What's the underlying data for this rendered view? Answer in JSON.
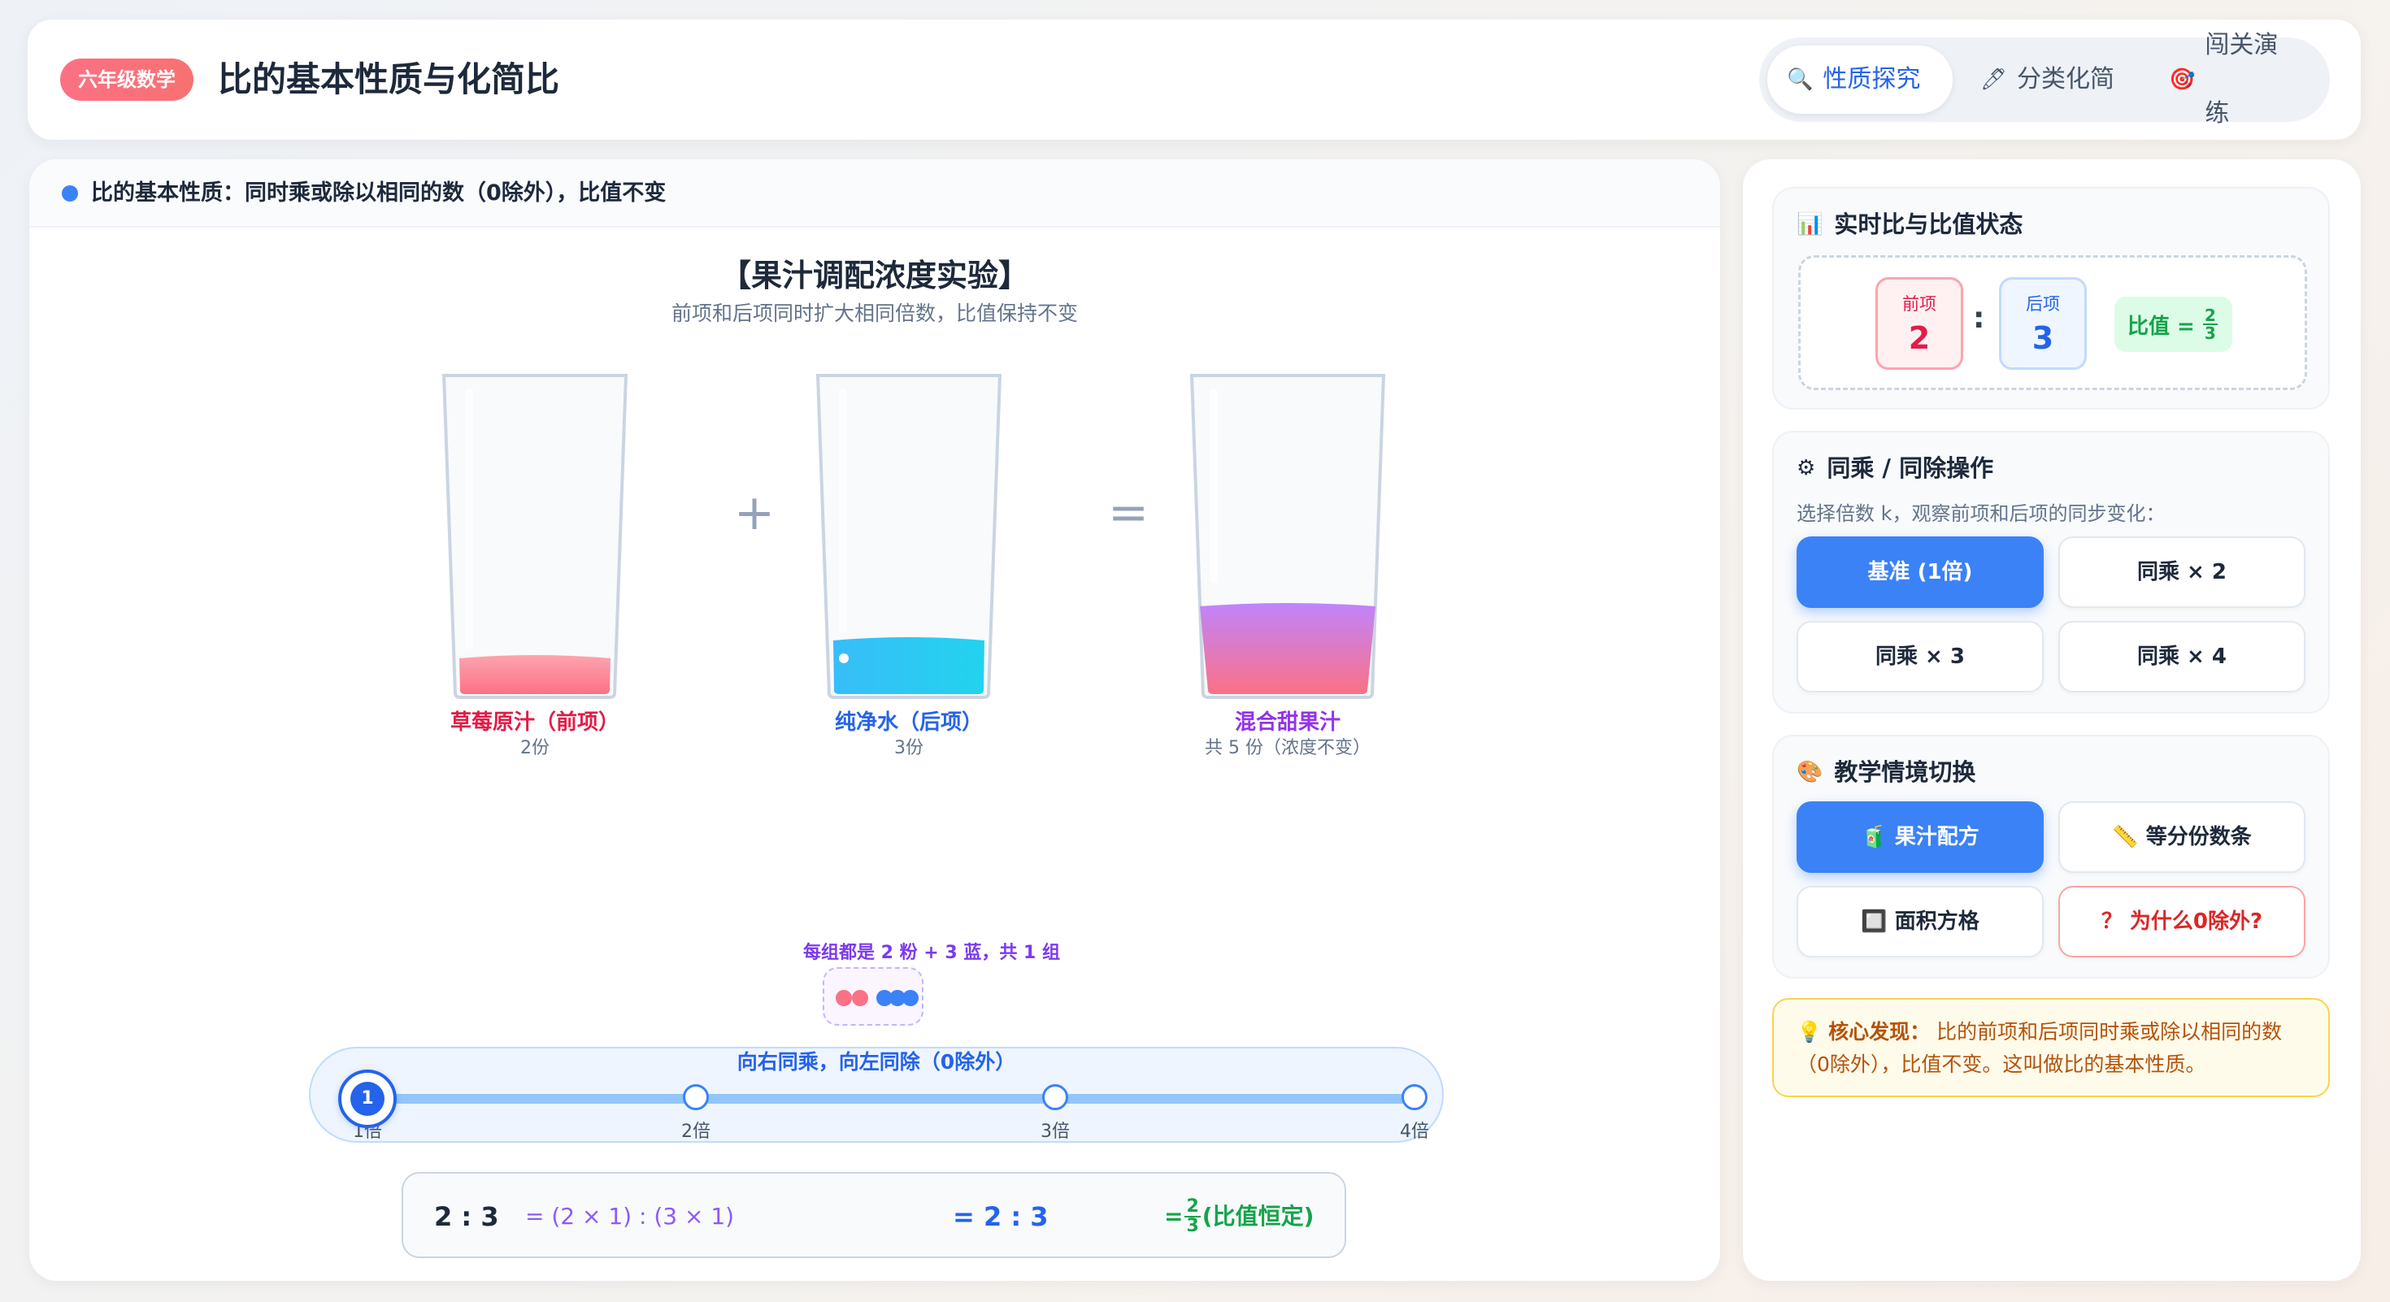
{
  "header": {
    "grade_badge": "六年级数学",
    "title": "比的基本性质与化简比",
    "tabs": [
      {
        "icon": "search-icon",
        "glyph": "🔍",
        "label": "性质探究",
        "active": true
      },
      {
        "icon": "pencil-icon",
        "glyph": "🖊",
        "label": "分类化简",
        "active": false
      },
      {
        "icon": "target-icon",
        "glyph": "🎯",
        "label": "闯关演练",
        "active": false
      }
    ]
  },
  "main": {
    "header_text": "比的基本性质：同时乘或除以相同的数（0除外），比值不变",
    "experiment_title": "【果汁调配浓度实验】",
    "experiment_subtitle": "前项和后项同时扩大相同倍数，比值保持不变",
    "cups": [
      {
        "label": "草莓原汁（前项）",
        "count": "2份",
        "color": "#e11d48"
      },
      {
        "label": "纯净水（后项）",
        "count": "3份",
        "color": "#2563eb"
      },
      {
        "label": "混合甜果汁",
        "count": "共 5 份（浓度不变）",
        "color": "#9333ea"
      }
    ],
    "plus": "+",
    "equals": "=",
    "group_caption": "每组都是 2 粉 + 3 蓝，共 1 组",
    "slider": {
      "caption": "向右同乘，向左同除（0除外）",
      "value": 1,
      "stops": [
        "1倍",
        "2倍",
        "3倍",
        "4倍"
      ]
    },
    "formula": {
      "base": "2 : 3",
      "expanded": "= (2 × 1) : (3 × 1)",
      "result": "= 2 : 3",
      "value_prefix": "=",
      "value_num": "2",
      "value_den": "3",
      "value_suffix": "(比值恒定)"
    }
  },
  "side": {
    "status": {
      "icon": "bar-chart-icon",
      "title": "实时比与比值状态",
      "front_label": "前项",
      "front_value": "2",
      "colon": ":",
      "back_label": "后项",
      "back_value": "3",
      "ratio_label": "比值 =",
      "ratio_num": "2",
      "ratio_den": "3"
    },
    "operation": {
      "icon": "gear-icon",
      "title": "同乘 / 同除操作",
      "hint": "选择倍数 k，观察前项和后项的同步变化：",
      "buttons": [
        {
          "label": "基准 (1倍)",
          "active": true
        },
        {
          "label": "同乘 × 2",
          "active": false
        },
        {
          "label": "同乘 × 3",
          "active": false
        },
        {
          "label": "同乘 × 4",
          "active": false
        }
      ]
    },
    "scenario": {
      "icon": "palette-icon",
      "title": "教学情境切换",
      "buttons": [
        {
          "label": "🧃 果汁配方",
          "active": true
        },
        {
          "label": "📏 等分份数条",
          "active": false
        },
        {
          "label": "🔲 面积方格",
          "active": false
        },
        {
          "label": "？ 为什么0除外?",
          "active": false,
          "warn": true
        }
      ]
    },
    "insight": {
      "icon": "lightbulb-icon",
      "label": "核心发现：",
      "text": "比的前项和后项同时乘或除以相同的数（0除外），比值不变。这叫做比的基本性质。"
    }
  },
  "colors": {
    "accent": "#3b82f6",
    "strawberry": "#fb7185",
    "water": "#38bdf8",
    "mix": "#c084fc"
  }
}
